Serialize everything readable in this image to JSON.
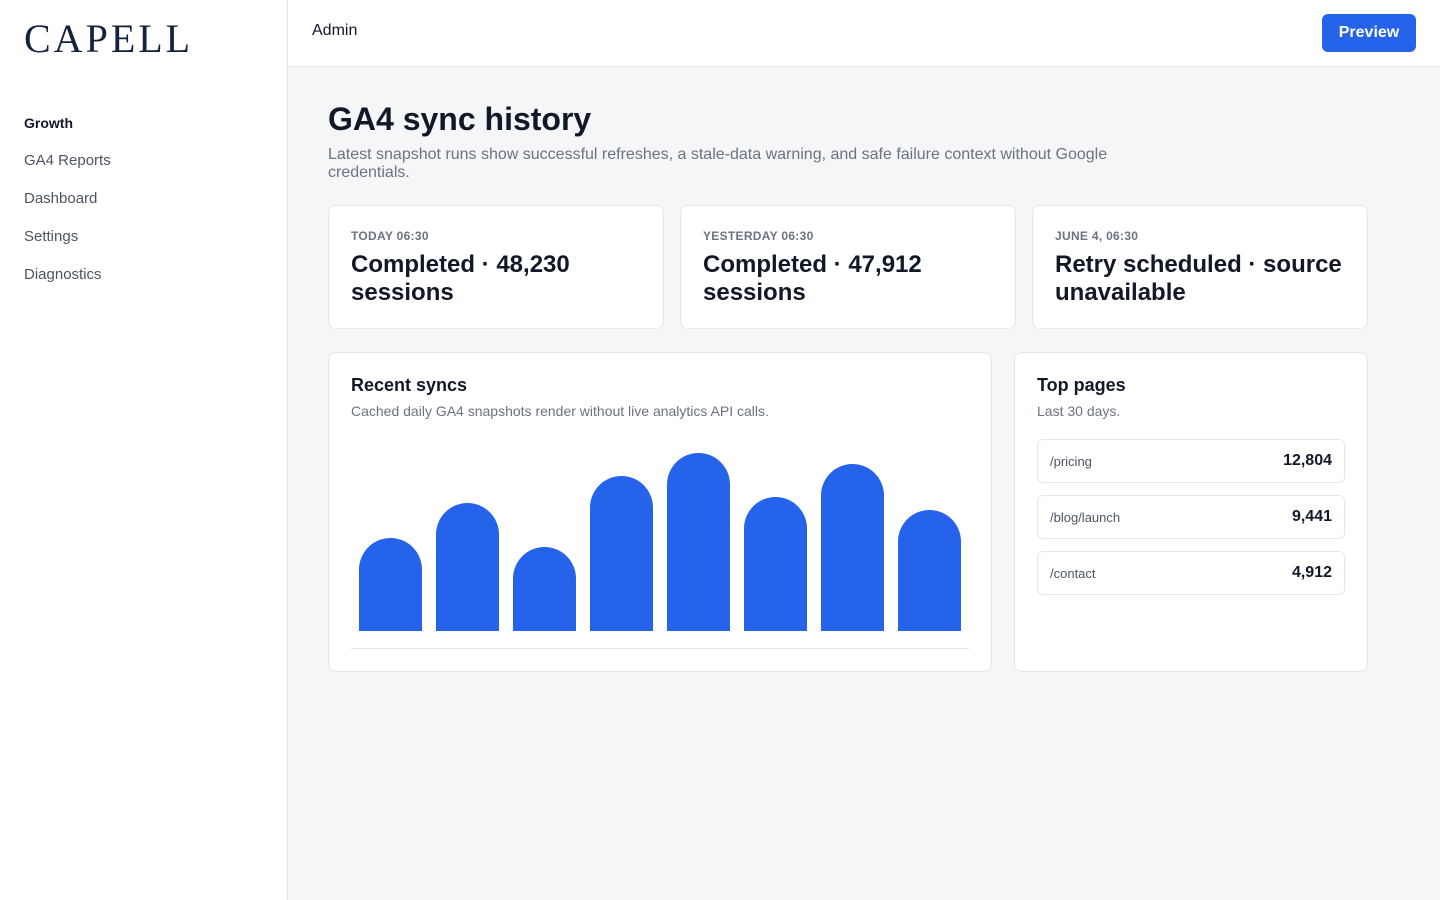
{
  "brand": {
    "name": "CAPELL"
  },
  "sidebar": {
    "section": "Growth",
    "items": [
      {
        "label": "GA4 Reports"
      },
      {
        "label": "Dashboard"
      },
      {
        "label": "Settings"
      },
      {
        "label": "Diagnostics"
      }
    ]
  },
  "topbar": {
    "title": "Admin",
    "preview_label": "Preview"
  },
  "page": {
    "title": "GA4 sync history",
    "subtitle": "Latest snapshot runs show successful refreshes, a stale-data warning, and safe failure context without Google credentials."
  },
  "cards": [
    {
      "label": "TODAY 06:30",
      "value": "Completed · 48,230 sessions"
    },
    {
      "label": "YESTERDAY 06:30",
      "value": "Completed · 47,912 sessions"
    },
    {
      "label": "JUNE 4, 06:30",
      "value": "Retry scheduled · source unavailable"
    }
  ],
  "recent_syncs": {
    "title": "Recent syncs",
    "subtitle": "Cached daily GA4 snapshots render without live analytics API calls."
  },
  "chart_data": {
    "type": "bar",
    "values": [
      52,
      72,
      47,
      87,
      100,
      75,
      94,
      68
    ],
    "ylim": [
      0,
      100
    ],
    "color": "#2563eb"
  },
  "top_pages": {
    "title": "Top pages",
    "subtitle": "Last 30 days.",
    "rows": [
      {
        "path": "/pricing",
        "count": "12,804"
      },
      {
        "path": "/blog/launch",
        "count": "9,441"
      },
      {
        "path": "/contact",
        "count": "4,912"
      }
    ]
  }
}
